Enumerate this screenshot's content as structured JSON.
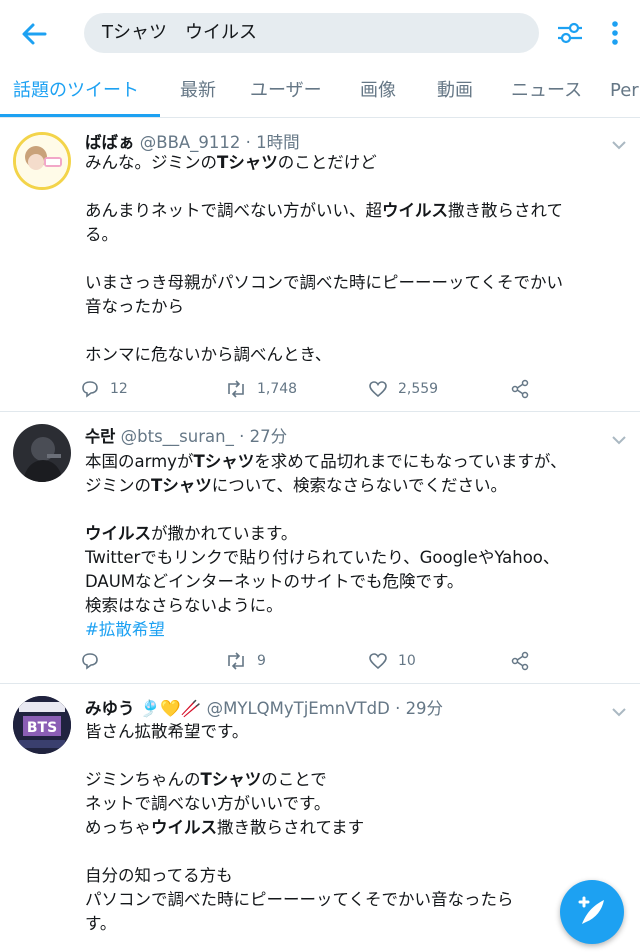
{
  "search": {
    "query": "Tシャツ　ウイルス"
  },
  "tabs": [
    "話題のツイート",
    "最新",
    "ユーザー",
    "画像",
    "動画",
    "ニュース",
    "Per"
  ],
  "tweets": [
    {
      "name": "ばばぁ",
      "handle": "@BBA_9112",
      "time": "1時間",
      "lines": [
        [
          "みんな。ジミンの",
          {
            "b": "Tシャツ"
          },
          "のことだけど"
        ],
        [],
        [
          "あんまりネットで調べない方がいい、超",
          {
            "b": "ウイルス"
          },
          "撒き散らされて"
        ],
        [
          "る。"
        ],
        [],
        [
          "いまさっき母親がパソコンで調べた時にピーーーッてくそでかい"
        ],
        [
          "音なったから"
        ],
        [],
        [
          "ホンマに危ないから調べんとき、"
        ]
      ],
      "replies": "12",
      "retweets": "1,748",
      "likes": "2,559"
    },
    {
      "name": "수란",
      "handle": "@bts__suran_",
      "time": "27分",
      "lines": [
        [
          "本国のarmyが",
          {
            "b": "Tシャツ"
          },
          "を求めて品切れまでにもなっていますが、"
        ],
        [
          "ジミンの",
          {
            "b": "Tシャツ"
          },
          "について、検索なさらないでください。"
        ],
        [],
        [
          {
            "b": "ウイルス"
          },
          "が撒かれています。"
        ],
        [
          "Twitterでもリンクで貼り付けられていたり、GoogleやYahoo、"
        ],
        [
          "DAUMなどインターネットのサイトでも危険です。"
        ],
        [
          "検索はなさらないように。"
        ],
        [
          {
            "h": "#拡散希望"
          }
        ]
      ],
      "replies": "",
      "retweets": "9",
      "likes": "10"
    },
    {
      "name": "みゆう",
      "emojis": "🎐💛🥢",
      "handle": "@MYLQMyTjEmnVTdD",
      "time": "29分",
      "lines": [
        [
          "皆さん拡散希望です。"
        ],
        [],
        [
          "ジミンちゃんの",
          {
            "b": "Tシャツ"
          },
          "のことで"
        ],
        [
          "ネットで調べない方がいいです。"
        ],
        [
          "めっちゃ",
          {
            "b": "ウイルス"
          },
          "撒き散らされてます"
        ],
        [],
        [
          "自分の知ってる方も"
        ],
        [
          "パソコンで調べた時にピーーーッてくそでかい音なったら"
        ],
        [
          "す。"
        ]
      ],
      "replies": "",
      "retweets": "",
      "likes": ""
    }
  ],
  "colors": {
    "accent": "#1da1f2",
    "muted": "#657786",
    "divider": "#e1e8ed"
  },
  "icons": [
    "back-arrow-icon",
    "filter-icon",
    "more-vertical-icon",
    "reply-icon",
    "retweet-icon",
    "like-icon",
    "share-icon",
    "compose-icon"
  ]
}
